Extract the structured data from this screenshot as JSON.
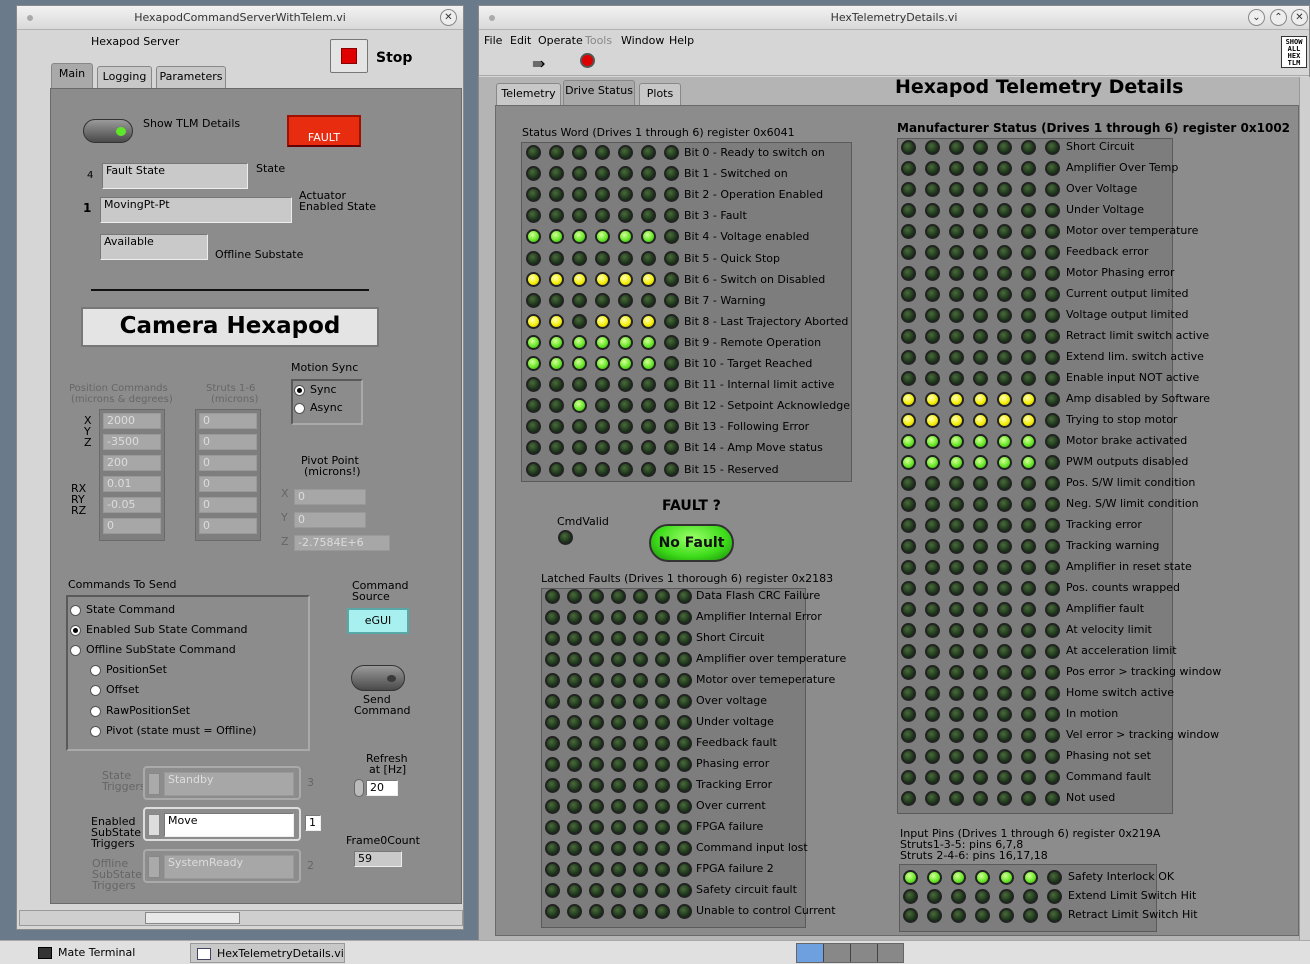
{
  "left_window": {
    "title": "HexapodCommandServerWithTelem.vi",
    "server_label": "Hexapod Server",
    "stop_label": "Stop",
    "tabs": [
      "Main",
      "Logging",
      "Parameters"
    ],
    "show_tlm_label": "Show TLM Details",
    "fault_button": "FAULT",
    "state_index": "4",
    "state_value": "Fault State",
    "state_label": "State",
    "actuator_index": "1",
    "actuator_value": "MovingPt-Pt",
    "actuator_label_1": "Actuator",
    "actuator_label_2": "Enabled State",
    "offline_value": "Available",
    "offline_label": "Offline Substate",
    "hexapod_name": "Camera Hexapod",
    "position_header_1": "Position Commands",
    "position_header_2": "(microns & degrees)",
    "struts_header_1": "Struts 1-6",
    "struts_header_2": "(microns)",
    "axis_labels": [
      "X",
      "Y",
      "Z",
      "RX",
      "RY",
      "RZ"
    ],
    "positions": [
      "2000",
      "-3500",
      "200",
      "0.01",
      "-0.05",
      "0"
    ],
    "struts": [
      "0",
      "0",
      "0",
      "0",
      "0",
      "0"
    ],
    "motion_sync_label": "Motion Sync",
    "sync_options": [
      "Sync",
      "Async"
    ],
    "pivot_label_1": "Pivot Point",
    "pivot_label_2": "(microns!)",
    "pivot_axes": [
      "X",
      "Y",
      "Z"
    ],
    "pivot_values": [
      "0",
      "0",
      "-2.7584E+6"
    ],
    "commands_label": "Commands To Send",
    "commands": [
      "State Command",
      "Enabled Sub State Command",
      "Offline SubState Command"
    ],
    "sub_commands": [
      "PositionSet",
      "Offset",
      "RawPositionSet",
      "Pivot (state must = Offline)"
    ],
    "command_source_1": "Command",
    "command_source_2": "Source",
    "egui": "eGUI",
    "send_1": "Send",
    "send_2": "Command",
    "refresh_1": "Refresh",
    "refresh_2": "at [Hz]",
    "refresh_value": "20",
    "state_triggers_1": "State",
    "state_triggers_2": "Triggers",
    "state_trigger_value": "Standby",
    "state_trigger_num": "3",
    "enabled_triggers_1": "Enabled",
    "enabled_triggers_2": "SubState",
    "enabled_triggers_3": "Triggers",
    "enabled_trigger_value": "Move",
    "enabled_trigger_num": "1",
    "offline_triggers_1": "Offline",
    "offline_triggers_2": "SubState",
    "offline_triggers_3": "Triggers",
    "offline_trigger_value": "SystemReady",
    "offline_trigger_num": "2",
    "frame_count_label": "Frame0Count",
    "frame_count_value": "59"
  },
  "right_window": {
    "title": "HexTelemetryDetails.vi",
    "menu": [
      "File",
      "Edit",
      "Operate",
      "Tools",
      "Window",
      "Help"
    ],
    "show_all_tlm": [
      "SHOW",
      "ALL",
      "HEX",
      "TLM"
    ],
    "tabs": [
      "Telemetry",
      "Drive Status",
      "Plots"
    ],
    "page_title": "Hexapod Telemetry Details",
    "status_word_title": "Status Word (Drives 1 through 6)  register 0x6041",
    "status_bits": [
      {
        "label": "Bit 0 - Ready to switch on",
        "leds": "dddddd"
      },
      {
        "label": "Bit 1 - Switched on",
        "leds": "dddddd"
      },
      {
        "label": "Bit 2 - Operation Enabled",
        "leds": "dddddd"
      },
      {
        "label": "Bit 3 - Fault",
        "leds": "dddddd"
      },
      {
        "label": "Bit 4 - Voltage enabled",
        "leds": "gggggg"
      },
      {
        "label": "Bit 5 - Quick Stop",
        "leds": "dddddd"
      },
      {
        "label": "Bit 6 - Switch on Disabled",
        "leds": "yyyyyy"
      },
      {
        "label": "Bit 7 - Warning",
        "leds": "dddddd"
      },
      {
        "label": "Bit 8 - Last Trajectory Aborted",
        "leds": "yydyyy"
      },
      {
        "label": "Bit 9 - Remote Operation",
        "leds": "gggggg"
      },
      {
        "label": "Bit 10 - Target Reached",
        "leds": "gggggg"
      },
      {
        "label": "Bit 11 - Internal limit active",
        "leds": "dddddd"
      },
      {
        "label": "Bit 12 - Setpoint Acknowledge",
        "leds": "ddgddd"
      },
      {
        "label": "Bit 13 - Following Error",
        "leds": "dddddd"
      },
      {
        "label": "Bit 14 - Amp Move status",
        "leds": "dddddd"
      },
      {
        "label": "Bit 15 - Reserved",
        "leds": "dddddd"
      }
    ],
    "fault_question": "FAULT ?",
    "cmd_valid": "CmdValid",
    "no_fault": "No Fault",
    "latched_title": "Latched Faults (Drives 1 thorough 6)  register 0x2183",
    "latched_faults": [
      "Data Flash CRC Failure",
      "Amplifier Internal Error",
      "Short Circuit",
      "Amplifier over temperature",
      "Motor over temeperature",
      "Over voltage",
      "Under voltage",
      "Feedback fault",
      "Phasing error",
      "Tracking Error",
      "Over current",
      "FPGA failure",
      "Command input lost",
      "FPGA failure 2",
      "Safety circuit fault",
      "Unable to control Current"
    ],
    "mfr_title": "Manufacturer Status (Drives 1 through 6)  register 0x1002",
    "mfr_status": [
      {
        "label": "Short Circuit",
        "leds": "dddddd"
      },
      {
        "label": "Amplifier Over Temp",
        "leds": "dddddd"
      },
      {
        "label": "Over Voltage",
        "leds": "dddddd"
      },
      {
        "label": "Under Voltage",
        "leds": "dddddd"
      },
      {
        "label": "Motor over temperature",
        "leds": "dddddd"
      },
      {
        "label": "Feedback error",
        "leds": "dddddd"
      },
      {
        "label": "Motor Phasing error",
        "leds": "dddddd"
      },
      {
        "label": "Current output limited",
        "leds": "dddddd"
      },
      {
        "label": "Voltage output limited",
        "leds": "dddddd"
      },
      {
        "label": "Retract limit switch active",
        "leds": "dddddd"
      },
      {
        "label": "Extend lim. switch active",
        "leds": "dddddd"
      },
      {
        "label": "Enable input NOT active",
        "leds": "dddddd"
      },
      {
        "label": "Amp disabled by Software",
        "leds": "yyyyyy"
      },
      {
        "label": "Trying to stop motor",
        "leds": "yyyyyy"
      },
      {
        "label": "Motor brake activated",
        "leds": "gggggg"
      },
      {
        "label": "PWM outputs disabled",
        "leds": "gggggg"
      },
      {
        "label": "Pos. S/W limit condition",
        "leds": "dddddd"
      },
      {
        "label": "Neg. S/W limit condition",
        "leds": "dddddd"
      },
      {
        "label": "Tracking error",
        "leds": "dddddd"
      },
      {
        "label": "Tracking warning",
        "leds": "dddddd"
      },
      {
        "label": "Amplifier in reset state",
        "leds": "dddddd"
      },
      {
        "label": "Pos. counts wrapped",
        "leds": "dddddd"
      },
      {
        "label": "Amplifier fault",
        "leds": "dddddd"
      },
      {
        "label": "At velocity limit",
        "leds": "dddddd"
      },
      {
        "label": "At acceleration limit",
        "leds": "dddddd"
      },
      {
        "label": "Pos error > tracking window",
        "leds": "dddddd"
      },
      {
        "label": "Home switch active",
        "leds": "dddddd"
      },
      {
        "label": "In motion",
        "leds": "dddddd"
      },
      {
        "label": "Vel error > tracking window",
        "leds": "dddddd"
      },
      {
        "label": "Phasing not set",
        "leds": "dddddd"
      },
      {
        "label": "Command fault",
        "leds": "dddddd"
      },
      {
        "label": "Not used",
        "leds": "dddddd"
      }
    ],
    "input_title": "Input Pins (Drives 1 through 6)  register 0x219A",
    "input_sub_1": "Struts1-3-5: pins 6,7,8",
    "input_sub_2": "Struts 2-4-6: pins 16,17,18",
    "input_pins": [
      {
        "label": "Safety Interlock OK",
        "leds": "gggggg"
      },
      {
        "label": "Extend Limit Switch Hit",
        "leds": "dddddd"
      },
      {
        "label": "Retract Limit Switch Hit",
        "leds": "dddddd"
      }
    ]
  },
  "taskbar": [
    "Mate Terminal",
    "HexTelemetryDetails.vi"
  ]
}
